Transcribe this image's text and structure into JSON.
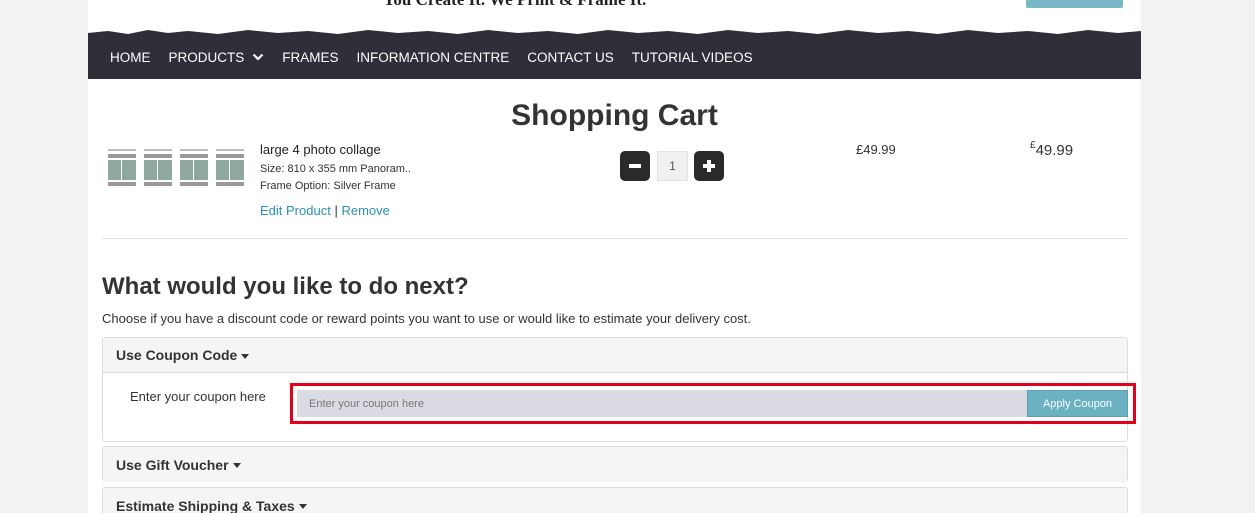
{
  "header": {
    "tagline": "You Create It. We Print & Frame It."
  },
  "nav": {
    "items": [
      "HOME",
      "PRODUCTS",
      "FRAMES",
      "INFORMATION CENTRE",
      "CONTACT US",
      "TUTORIAL VIDEOS"
    ]
  },
  "cart": {
    "title": "Shopping Cart",
    "product": {
      "name": "large 4 photo collage",
      "size": "Size: 810 x 355 mm Panoram..",
      "frame": "Frame Option: Silver Frame",
      "edit_label": "Edit Product",
      "separator": "|",
      "remove_label": "Remove",
      "quantity": "1",
      "unit_price": "£49.99",
      "total_currency": "£",
      "total_amount": "49.99"
    }
  },
  "next": {
    "title": "What would you like to do next?",
    "description": "Choose if you have a discount code or reward points you want to use or would like to estimate your delivery cost."
  },
  "coupon": {
    "heading": "Use Coupon Code",
    "label": "Enter your coupon here",
    "placeholder": "Enter your coupon here",
    "button": "Apply Coupon"
  },
  "voucher": {
    "heading": "Use Gift Voucher"
  },
  "shipping": {
    "heading": "Estimate Shipping & Taxes"
  },
  "colors": {
    "navbar": "#2e2f38",
    "link": "#2a8fb5",
    "apply_button": "#6ab2c2",
    "highlight": "#e3001b"
  }
}
